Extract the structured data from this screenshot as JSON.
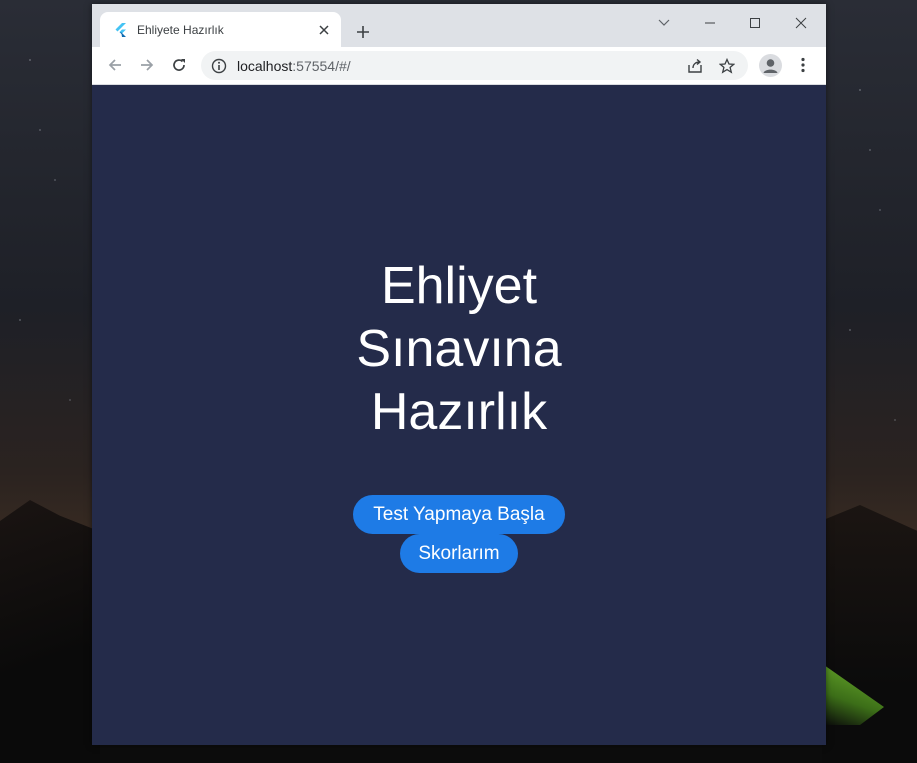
{
  "tab": {
    "title": "Ehliyete Hazırlık"
  },
  "address_bar": {
    "host": "localhost",
    "path": ":57554/#/"
  },
  "page": {
    "heading_lines": [
      "Ehliyet",
      "Sınavına",
      "Hazırlık"
    ],
    "start_button": "Test Yapmaya Başla",
    "scores_button": "Skorlarım"
  },
  "icons": {
    "favicon": "flutter-icon",
    "tab_close": "close-icon",
    "new_tab": "plus-icon",
    "back": "arrow-left-icon",
    "forward": "arrow-right-icon",
    "reload": "reload-icon",
    "site_info": "info-icon",
    "share": "share-icon",
    "bookmark": "star-icon",
    "profile": "account-icon",
    "menu": "kebab-menu-icon",
    "tab_search": "chevron-down-icon",
    "minimize": "minimize-icon",
    "maximize": "maximize-icon",
    "close_window": "close-window-icon"
  },
  "colors": {
    "page_background": "#242b4a",
    "button": "#1e7be6",
    "heading_text": "#ffffff"
  }
}
